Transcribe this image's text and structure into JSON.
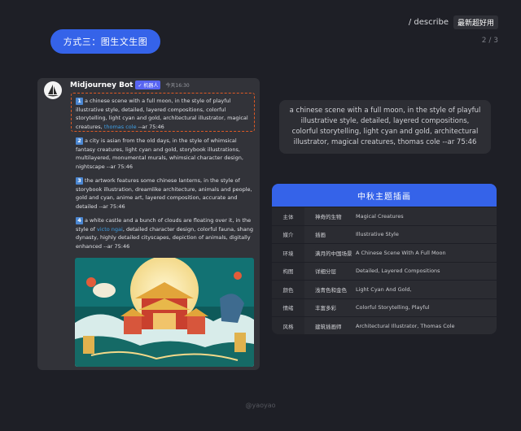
{
  "header": {
    "command": "/ describe",
    "badge": "最新超好用",
    "page": "2 / 3"
  },
  "method_pill": "方式三：图生文生图",
  "discord": {
    "bot_name": "Midjourney Bot",
    "bot_badge": "✓ 机器人",
    "time": "今天16:30",
    "prompts": [
      {
        "num": "1",
        "text_before": "a chinese scene with a full moon, in the style of playful illustrative style, detailed, layered compositions, colorful storytelling, light cyan and gold, architectural illustrator, magical creatures, ",
        "link": "thomas cole",
        "text_after": " --ar 75:46"
      },
      {
        "num": "2",
        "text_before": "a city is asian from the old days, in the style of whimsical fantasy creatures, light cyan and gold, storybook illustrations, multilayered, monumental murals, whimsical character design, nightscape --ar 75:46",
        "link": "",
        "text_after": ""
      },
      {
        "num": "3",
        "text_before": "the artwork features some chinese lanterns, in the style of storybook illustration, dreamlike architecture, animals and people, gold and cyan, anime art, layered composition, accurate and detailed --ar 75:46",
        "link": "",
        "text_after": ""
      },
      {
        "num": "4",
        "text_before": "a white castle and a bunch of clouds are floating over it, in the style of ",
        "link": "victo ngai",
        "text_after": ", detailed character design, colorful fauna, shang dynasty, highly detailed cityscapes, depiction of animals, digitally enhanced --ar 75:46"
      }
    ]
  },
  "description": "a chinese scene with a full moon, in the style of playful illustrative style, detailed, layered compositions, colorful storytelling, light cyan and gold, architectural illustrator, magical creatures, thomas cole --ar 75:46",
  "table": {
    "title": "中秋主题插画",
    "rows": [
      {
        "key": "主体",
        "cn": "神奇的生物",
        "en": "Magical Creatures"
      },
      {
        "key": "媒介",
        "cn": "插画",
        "en": "Illustrative Style"
      },
      {
        "key": "环境",
        "cn": "满月的中国场景",
        "en": "A Chinese Scene With A Full Moon"
      },
      {
        "key": "构图",
        "cn": "详细分层",
        "en": "Detailed, Layered Compositions"
      },
      {
        "key": "颜色",
        "cn": "浅青色和金色",
        "en": "Light Cyan And Gold,"
      },
      {
        "key": "情绪",
        "cn": "丰富多彩",
        "en": "Colorful Storytelling, Playful"
      },
      {
        "key": "风格",
        "cn": "建筑插画师",
        "en": "Architectural Illustrator, Thomas Cole"
      }
    ]
  },
  "watermark": "@yaoyao",
  "colors": {
    "accent": "#3563e9",
    "background": "#1e1f26",
    "highlight_border": "#e05a24",
    "link": "#3fa0e6"
  }
}
